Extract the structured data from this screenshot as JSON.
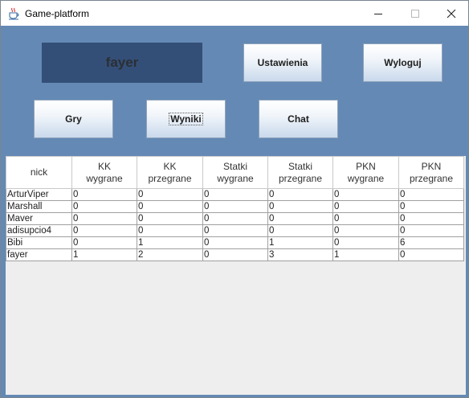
{
  "window": {
    "title": "Game-platform",
    "icon": "java-cup-icon",
    "controls": {
      "minimize": "minimize-icon",
      "maximize": "maximize-icon",
      "close": "close-icon"
    }
  },
  "user": {
    "name": "fayer"
  },
  "buttons": {
    "settings": "Ustawienia",
    "logout": "Wyloguj",
    "games": "Gry",
    "results": "Wyniki",
    "chat": "Chat"
  },
  "table": {
    "headers": [
      "nick",
      "KK\nwygrane",
      "KK\nprzegrane",
      "Statki\nwygrane",
      "Statki\nprzegrane",
      "PKN\nwygrane",
      "PKN\nprzegrane"
    ],
    "rows": [
      [
        "ArturViper",
        "0",
        "0",
        "0",
        "0",
        "0",
        "0"
      ],
      [
        "Marshall",
        "0",
        "0",
        "0",
        "0",
        "0",
        "0"
      ],
      [
        "Maver",
        "0",
        "0",
        "0",
        "0",
        "0",
        "0"
      ],
      [
        "adisupcio4",
        "0",
        "0",
        "0",
        "0",
        "0",
        "0"
      ],
      [
        "Bibi",
        "0",
        "1",
        "0",
        "1",
        "0",
        "6"
      ],
      [
        "fayer",
        "1",
        "2",
        "0",
        "3",
        "1",
        "0"
      ]
    ]
  },
  "colors": {
    "background": "#6489b4",
    "user_box": "#344f77",
    "table_empty": "#eeeeee"
  }
}
